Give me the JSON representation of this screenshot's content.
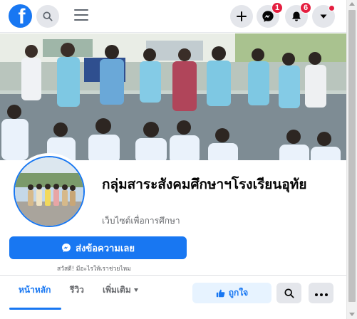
{
  "header": {
    "logo_letter": "f",
    "messenger_badge": "1",
    "notifications_badge": "6"
  },
  "page": {
    "name": "กลุ่มสาระสังคมศึกษาฯโรงเรียนอุทัย",
    "category": "เว็บไซต์เพื่อการศึกษา"
  },
  "actions": {
    "send_message": "ส่งข้อความเลย",
    "greeting": "สวัสดี! มีอะไรให้เราช่วยไหม",
    "like": "ถูกใจ"
  },
  "tabs": [
    {
      "label": "หน้าหลัก",
      "active": true
    },
    {
      "label": "รีวิว",
      "active": false
    },
    {
      "label": "เพิ่มเติม",
      "active": false
    }
  ],
  "colors": {
    "brand": "#1877f2",
    "badge": "#e41e3f"
  }
}
